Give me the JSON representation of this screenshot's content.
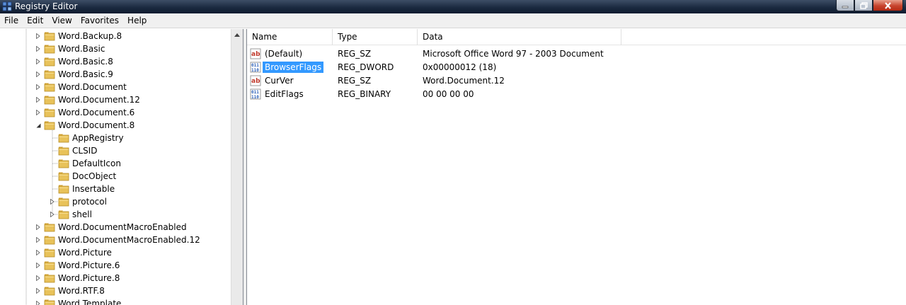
{
  "window": {
    "title": "Registry Editor"
  },
  "menu": [
    "File",
    "Edit",
    "View",
    "Favorites",
    "Help"
  ],
  "tree": [
    {
      "label": "Word.Backup.8",
      "indent": 0,
      "expander": "collapsed"
    },
    {
      "label": "Word.Basic",
      "indent": 0,
      "expander": "collapsed"
    },
    {
      "label": "Word.Basic.8",
      "indent": 0,
      "expander": "collapsed"
    },
    {
      "label": "Word.Basic.9",
      "indent": 0,
      "expander": "collapsed"
    },
    {
      "label": "Word.Document",
      "indent": 0,
      "expander": "collapsed"
    },
    {
      "label": "Word.Document.12",
      "indent": 0,
      "expander": "collapsed"
    },
    {
      "label": "Word.Document.6",
      "indent": 0,
      "expander": "collapsed"
    },
    {
      "label": "Word.Document.8",
      "indent": 0,
      "expander": "expanded"
    },
    {
      "label": "AppRegistry",
      "indent": 1,
      "expander": "none"
    },
    {
      "label": "CLSID",
      "indent": 1,
      "expander": "none"
    },
    {
      "label": "DefaultIcon",
      "indent": 1,
      "expander": "none"
    },
    {
      "label": "DocObject",
      "indent": 1,
      "expander": "none"
    },
    {
      "label": "Insertable",
      "indent": 1,
      "expander": "none"
    },
    {
      "label": "protocol",
      "indent": 1,
      "expander": "collapsed"
    },
    {
      "label": "shell",
      "indent": 1,
      "expander": "collapsed"
    },
    {
      "label": "Word.DocumentMacroEnabled",
      "indent": 0,
      "expander": "collapsed"
    },
    {
      "label": "Word.DocumentMacroEnabled.12",
      "indent": 0,
      "expander": "collapsed"
    },
    {
      "label": "Word.Picture",
      "indent": 0,
      "expander": "collapsed"
    },
    {
      "label": "Word.Picture.6",
      "indent": 0,
      "expander": "collapsed"
    },
    {
      "label": "Word.Picture.8",
      "indent": 0,
      "expander": "collapsed"
    },
    {
      "label": "Word.RTF.8",
      "indent": 0,
      "expander": "collapsed"
    },
    {
      "label": "Word.Template",
      "indent": 0,
      "expander": "collapsed"
    }
  ],
  "list": {
    "columns": [
      "Name",
      "Type",
      "Data"
    ],
    "rows": [
      {
        "name": "(Default)",
        "type": "REG_SZ",
        "data": "Microsoft Office Word 97 - 2003 Document",
        "icon": "string-value-icon",
        "selected": false
      },
      {
        "name": "BrowserFlags",
        "type": "REG_DWORD",
        "data": "0x00000012 (18)",
        "icon": "binary-value-icon",
        "selected": true
      },
      {
        "name": "CurVer",
        "type": "REG_SZ",
        "data": "Word.Document.12",
        "icon": "string-value-icon",
        "selected": false
      },
      {
        "name": "EditFlags",
        "type": "REG_BINARY",
        "data": "00 00 00 00",
        "icon": "binary-value-icon",
        "selected": false
      }
    ]
  },
  "colors": {
    "selection": "#3399ff",
    "folder": "#e8c25a"
  }
}
